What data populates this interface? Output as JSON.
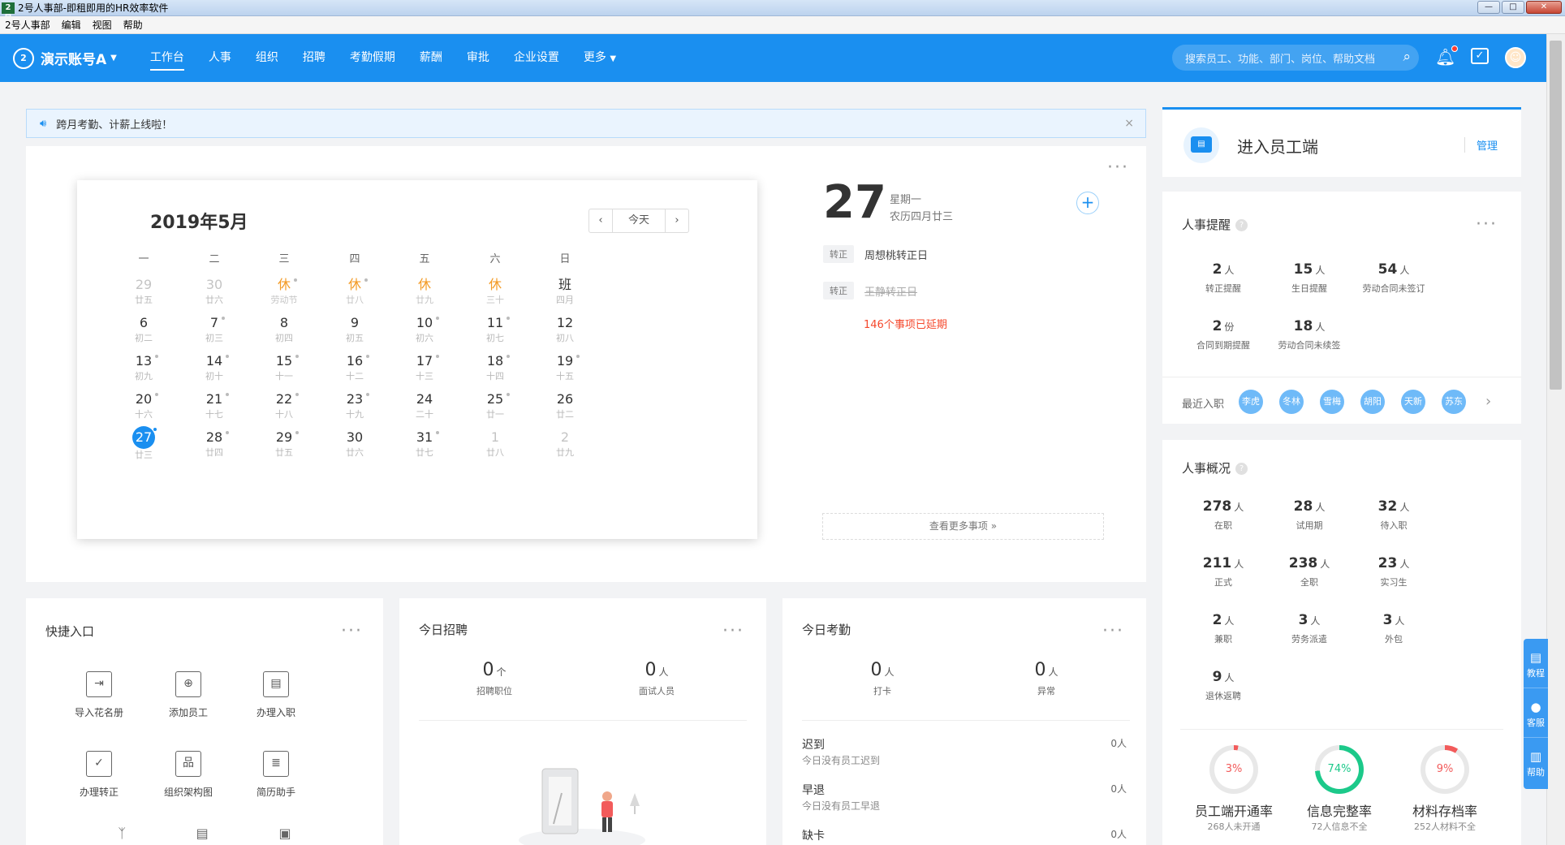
{
  "window": {
    "title": "2号人事部-即租即用的HR效率软件",
    "app_icon": "2号",
    "controls": [
      "—",
      "□",
      "✕"
    ]
  },
  "menubar": [
    "2号人事部",
    "编辑",
    "视图",
    "帮助"
  ],
  "nav": {
    "logo": "2",
    "account": "演示账号A",
    "items": [
      "工作台",
      "人事",
      "组织",
      "招聘",
      "考勤假期",
      "薪酬",
      "审批",
      "企业设置",
      "更多"
    ],
    "active": "工作台",
    "search_placeholder": "搜索员工、功能、部门、岗位、帮助文档",
    "accent": "#1a8ff0"
  },
  "notice": {
    "text": "跨月考勤、计薪上线啦！"
  },
  "calendar": {
    "title": "2019年5月",
    "today_btn": "今天",
    "weekdays": [
      "一",
      "二",
      "三",
      "四",
      "五",
      "六",
      "日"
    ],
    "weeks": [
      [
        {
          "n": "29",
          "s": "廿五",
          "t": "dim"
        },
        {
          "n": "30",
          "s": "廿六",
          "t": "dim"
        },
        {
          "n": "休",
          "s": "劳动节",
          "t": "hol",
          "d": true
        },
        {
          "n": "休",
          "s": "廿八",
          "t": "hol",
          "d": true
        },
        {
          "n": "休",
          "s": "廿九",
          "t": "hol"
        },
        {
          "n": "休",
          "s": "三十",
          "t": "hol"
        },
        {
          "n": "班",
          "s": "四月",
          "t": ""
        }
      ],
      [
        {
          "n": "6",
          "s": "初二",
          "t": ""
        },
        {
          "n": "7",
          "s": "初三",
          "t": "",
          "d": true
        },
        {
          "n": "8",
          "s": "初四",
          "t": ""
        },
        {
          "n": "9",
          "s": "初五",
          "t": ""
        },
        {
          "n": "10",
          "s": "初六",
          "t": "",
          "d": true
        },
        {
          "n": "11",
          "s": "初七",
          "t": "",
          "d": true
        },
        {
          "n": "12",
          "s": "初八",
          "t": ""
        }
      ],
      [
        {
          "n": "13",
          "s": "初九",
          "t": "",
          "d": true
        },
        {
          "n": "14",
          "s": "初十",
          "t": "",
          "d": true
        },
        {
          "n": "15",
          "s": "十一",
          "t": "",
          "d": true
        },
        {
          "n": "16",
          "s": "十二",
          "t": "",
          "d": true
        },
        {
          "n": "17",
          "s": "十三",
          "t": "",
          "d": true
        },
        {
          "n": "18",
          "s": "十四",
          "t": "",
          "d": true
        },
        {
          "n": "19",
          "s": "十五",
          "t": "",
          "d": true
        }
      ],
      [
        {
          "n": "20",
          "s": "十六",
          "t": "",
          "d": true
        },
        {
          "n": "21",
          "s": "十七",
          "t": "",
          "d": true
        },
        {
          "n": "22",
          "s": "十八",
          "t": "",
          "d": true
        },
        {
          "n": "23",
          "s": "十九",
          "t": "",
          "d": true
        },
        {
          "n": "24",
          "s": "二十",
          "t": ""
        },
        {
          "n": "25",
          "s": "廿一",
          "t": "",
          "d": true
        },
        {
          "n": "26",
          "s": "廿二",
          "t": ""
        }
      ],
      [
        {
          "n": "27",
          "s": "廿三",
          "t": "sel",
          "d": true
        },
        {
          "n": "28",
          "s": "廿四",
          "t": "",
          "d": true
        },
        {
          "n": "29",
          "s": "廿五",
          "t": "",
          "d": true
        },
        {
          "n": "30",
          "s": "廿六",
          "t": ""
        },
        {
          "n": "31",
          "s": "廿七",
          "t": "",
          "d": true
        },
        {
          "n": "1",
          "s": "廿八",
          "t": "dim"
        },
        {
          "n": "2",
          "s": "廿九",
          "t": "dim"
        }
      ]
    ]
  },
  "day_detail": {
    "day": "27",
    "weekday": "星期一",
    "lunar": "农历四月廿三",
    "events": [
      {
        "tag": "转正",
        "text": "周想桃转正日",
        "done": false
      },
      {
        "tag": "转正",
        "text": "王静转正日",
        "done": true
      }
    ],
    "overdue": "146个事项已延期",
    "more": "查看更多事项 »"
  },
  "employee_portal": {
    "title": "进入员工端",
    "manage": "管理"
  },
  "hr_reminders": {
    "title": "人事提醒",
    "stats": [
      {
        "v": "2",
        "u": "人",
        "l": "转正提醒"
      },
      {
        "v": "15",
        "u": "人",
        "l": "生日提醒"
      },
      {
        "v": "54",
        "u": "人",
        "l": "劳动合同未签订"
      },
      {
        "v": "2",
        "u": "份",
        "l": "合同到期提醒"
      },
      {
        "v": "18",
        "u": "人",
        "l": "劳动合同未续签"
      }
    ],
    "recent_label": "最近入职",
    "recent": [
      "李虎",
      "冬林",
      "雪梅",
      "胡阳",
      "天新",
      "苏东"
    ]
  },
  "hr_overview": {
    "title": "人事概况",
    "stats": [
      {
        "v": "278",
        "u": "人",
        "l": "在职"
      },
      {
        "v": "28",
        "u": "人",
        "l": "试用期"
      },
      {
        "v": "32",
        "u": "人",
        "l": "待入职"
      },
      {
        "v": "211",
        "u": "人",
        "l": "正式"
      },
      {
        "v": "238",
        "u": "人",
        "l": "全职"
      },
      {
        "v": "23",
        "u": "人",
        "l": "实习生"
      },
      {
        "v": "2",
        "u": "人",
        "l": "兼职"
      },
      {
        "v": "3",
        "u": "人",
        "l": "劳务派遣"
      },
      {
        "v": "3",
        "u": "人",
        "l": "外包"
      },
      {
        "v": "9",
        "u": "人",
        "l": "退休返聘"
      }
    ],
    "rings": [
      {
        "pct": "3%",
        "value": 3,
        "title": "员工端开通率",
        "sub": "268人未开通",
        "color": "#f25b5b"
      },
      {
        "pct": "74%",
        "value": 74,
        "title": "信息完整率",
        "sub": "72人信息不全",
        "color": "#1cc98a"
      },
      {
        "pct": "9%",
        "value": 9,
        "title": "材料存档率",
        "sub": "252人材料不全",
        "color": "#f25b5b"
      }
    ]
  },
  "quick": {
    "title": "快捷入口",
    "items": [
      {
        "label": "导入花名册",
        "icon": "import-icon",
        "g": "⇥"
      },
      {
        "label": "添加员工",
        "icon": "add-user-icon",
        "g": "⊕"
      },
      {
        "label": "办理入职",
        "icon": "onboard-icon",
        "g": "▤"
      },
      {
        "label": "办理转正",
        "icon": "promote-icon",
        "g": "✓"
      },
      {
        "label": "组织架构图",
        "icon": "org-chart-icon",
        "g": "品"
      },
      {
        "label": "简历助手",
        "icon": "resume-icon",
        "g": "≣"
      }
    ]
  },
  "recruit": {
    "title": "今日招聘",
    "stats": [
      {
        "v": "0",
        "u": "个",
        "l": "招聘职位"
      },
      {
        "v": "0",
        "u": "人",
        "l": "面试人员"
      }
    ]
  },
  "attendance": {
    "title": "今日考勤",
    "stats": [
      {
        "v": "0",
        "u": "人",
        "l": "打卡"
      },
      {
        "v": "0",
        "u": "人",
        "l": "异常"
      }
    ],
    "rows": [
      {
        "name": "迟到",
        "desc": "今日没有员工迟到",
        "count": "0人"
      },
      {
        "name": "早退",
        "desc": "今日没有员工早退",
        "count": "0人"
      },
      {
        "name": "缺卡",
        "desc": "",
        "count": "0人"
      }
    ]
  },
  "side_tabs": [
    "教程",
    "客服",
    "帮助"
  ]
}
